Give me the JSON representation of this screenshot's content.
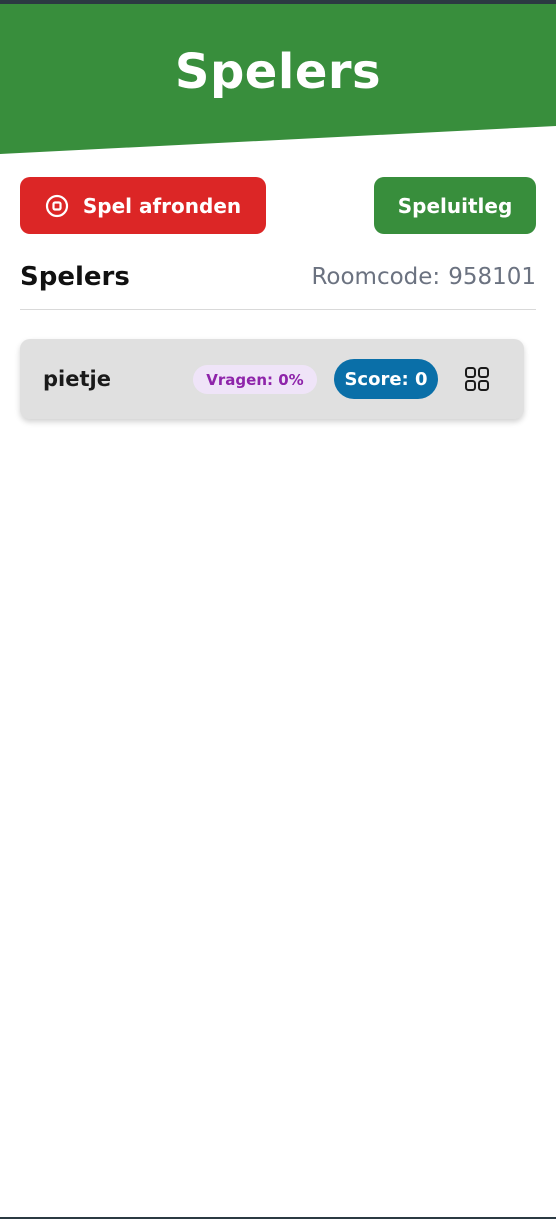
{
  "header": {
    "title": "Spelers",
    "background_color": "#388e3c"
  },
  "actions": {
    "finish_label": "Spel afronden",
    "finish_icon": "stop-circle-icon",
    "finish_color": "#dc2626",
    "help_label": "Speluitleg",
    "help_color": "#388e3c"
  },
  "players_section": {
    "title": "Spelers",
    "roomcode_label": "Roomcode:",
    "roomcode_value": "958101"
  },
  "players": [
    {
      "name": "pietje",
      "questions_badge": "Vragen: 0%",
      "score_badge": "Score: 0",
      "action_icon": "grid-icon"
    }
  ]
}
